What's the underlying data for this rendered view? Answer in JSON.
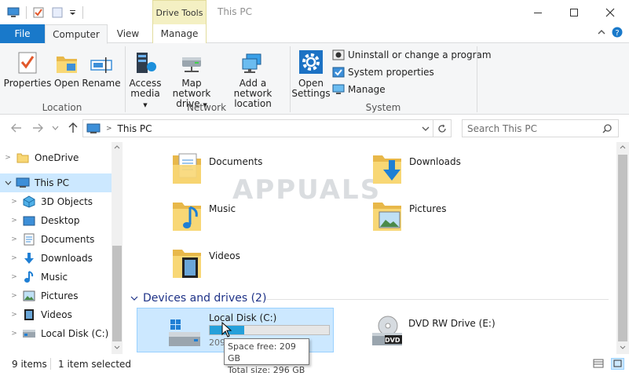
{
  "window": {
    "title": "This PC",
    "context_tab_group": "Drive Tools"
  },
  "tabs": {
    "file": "File",
    "computer": "Computer",
    "view": "View",
    "manage": "Manage"
  },
  "ribbon": {
    "location": {
      "label": "Location",
      "properties": "Properties",
      "open": "Open",
      "rename": "Rename"
    },
    "network": {
      "label": "Network",
      "access_media_1": "Access",
      "access_media_2": "media",
      "map_drive_1": "Map network",
      "map_drive_2": "drive",
      "add_location_1": "Add a network",
      "add_location_2": "location"
    },
    "system": {
      "label": "System",
      "open_settings_1": "Open",
      "open_settings_2": "Settings",
      "uninstall": "Uninstall or change a program",
      "system_properties": "System properties",
      "manage": "Manage"
    }
  },
  "address": {
    "path": "This PC",
    "search_placeholder": "Search This PC"
  },
  "nav": {
    "items": [
      {
        "label": "OneDrive"
      },
      {
        "label": "This PC"
      },
      {
        "label": "3D Objects"
      },
      {
        "label": "Desktop"
      },
      {
        "label": "Documents"
      },
      {
        "label": "Downloads"
      },
      {
        "label": "Music"
      },
      {
        "label": "Pictures"
      },
      {
        "label": "Videos"
      },
      {
        "label": "Local Disk (C:)"
      }
    ]
  },
  "folders": {
    "documents": "Documents",
    "downloads": "Downloads",
    "music": "Music",
    "pictures": "Pictures",
    "videos": "Videos"
  },
  "devices": {
    "header": "Devices and drives (2)",
    "local_disk": {
      "name": "Local Disk (C:)",
      "partial_text": "209",
      "used_fraction": 0.29
    },
    "dvd": {
      "name": "DVD RW Drive (E:)",
      "badge": "DVD"
    }
  },
  "tooltip": {
    "line1": "Space free: 209 GB",
    "line2": "Total size: 296 GB"
  },
  "watermark": "APPUALS",
  "status": {
    "items": "9 items",
    "selected": "1 item selected"
  },
  "colors": {
    "accent": "#1979ca",
    "selection": "#cce8ff",
    "selection_border": "#99d1ff",
    "drive_bar": "#26a0da",
    "context_tab": "#f4f0c3"
  }
}
